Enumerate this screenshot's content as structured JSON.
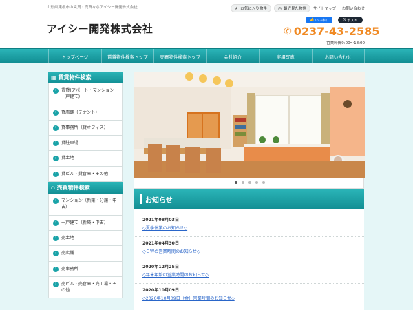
{
  "header": {
    "tagline": "山形県東根市の賃貸・売買ならアイシー開発株式会社",
    "favorites_label": "お気に入り物件",
    "recent_label": "最近見た物件",
    "sitemap_label": "サイトマップ",
    "contact_link_label": "お問い合わせ",
    "logo_text": "アイシー開発株式会社",
    "facebook_label": "いいね！",
    "twitter_label": "ポスト",
    "phone_number": "0237-43-2585",
    "hours": "営業時間9:00～18:00",
    "accent_color": "#f08a24"
  },
  "nav": {
    "items": [
      {
        "label": "トップページ"
      },
      {
        "label": "賃貸物件検索トップ"
      },
      {
        "label": "売買物件検索トップ"
      },
      {
        "label": "会社紹介"
      },
      {
        "label": "実績写真"
      },
      {
        "label": "お問い合わせ"
      }
    ],
    "color": "#1aa3a8"
  },
  "sidebar": {
    "rental_heading": "賃貸物件検索",
    "rental_items": [
      {
        "label": "賃貸(アパート・マンション・一戸建て)"
      },
      {
        "label": "貸店舗（テナント）"
      },
      {
        "label": "貸事務所（貸オフィス）"
      },
      {
        "label": "貸駐車場"
      },
      {
        "label": "貸土地"
      },
      {
        "label": "貸ビル・貸倉庫・その他"
      }
    ],
    "sale_heading": "売買物件検索",
    "sale_items": [
      {
        "label": "マンション（新築・分譲・中古）"
      },
      {
        "label": "一戸建て（新築・中古）"
      },
      {
        "label": "売土地"
      },
      {
        "label": "売店舗"
      },
      {
        "label": "売事務所"
      },
      {
        "label": "売ビル・売倉庫・売工場・その他"
      }
    ]
  },
  "slider": {
    "slide_count": 5,
    "active_index": 0
  },
  "news": {
    "heading": "お知らせ",
    "items": [
      {
        "date": "2021年08月03日",
        "title": "◇夏季休業のお知らせ◇"
      },
      {
        "date": "2021年04月30日",
        "title": "◇ＧＷの営業時間のお知らせ◇"
      },
      {
        "date": "2020年12月25日",
        "title": "◇年末年始の営業時間のお知らせ◇"
      },
      {
        "date": "2020年10月09日",
        "title": "◇2020年10月09日（金）営業時間のお知らせ◇"
      }
    ]
  }
}
